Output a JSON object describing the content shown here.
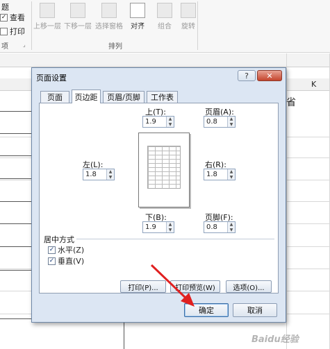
{
  "ribbon": {
    "show_group": {
      "title_partial": "题",
      "view_label": "查看",
      "print_label": "打印",
      "group_label_partial": "项"
    },
    "arrange": {
      "bring_forward": "上移一层",
      "send_backward": "下移一层",
      "selection_pane": "选择窗格",
      "align": "对齐",
      "group": "组合",
      "rotate": "旋转",
      "group_label": "排列"
    }
  },
  "sheet": {
    "column_k": "K",
    "cell_partial": "省"
  },
  "dialog": {
    "title": "页面设置",
    "help": "?",
    "close": "✕",
    "tabs": [
      "页面",
      "页边距",
      "页眉/页脚",
      "工作表"
    ],
    "selected_tab": "页边距",
    "margins": {
      "top_label": "上(T):",
      "top_value": "1.9",
      "header_label": "页眉(A):",
      "header_value": "0.8",
      "left_label": "左(L):",
      "left_value": "1.8",
      "right_label": "右(R):",
      "right_value": "1.8",
      "bottom_label": "下(B):",
      "bottom_value": "1.9",
      "footer_label": "页脚(F):",
      "footer_value": "0.8"
    },
    "center": {
      "title": "居中方式",
      "horizontal": "水平(Z)",
      "vertical": "垂直(V)",
      "horizontal_checked": true,
      "vertical_checked": true
    },
    "buttons": {
      "print": "打印(P)...",
      "print_preview": "打印预览(W)",
      "options": "选项(O)...",
      "ok": "确定",
      "cancel": "取消"
    }
  },
  "watermark": "Baidu经验",
  "colors": {
    "dialog_bg": "#dce6f3",
    "close_red": "#c4442d",
    "arrow_red": "#e02020"
  }
}
